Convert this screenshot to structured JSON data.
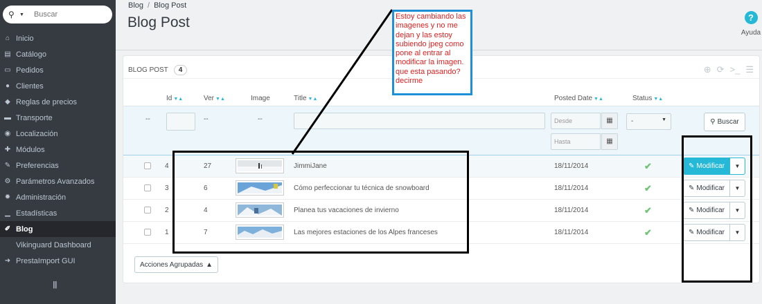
{
  "search": {
    "placeholder": "Buscar",
    "icon": "search-icon"
  },
  "sidebar": {
    "items": [
      {
        "label": "Inicio",
        "icon": "home-icon",
        "glyph": "⌂"
      },
      {
        "label": "Catálogo",
        "icon": "book-icon",
        "glyph": "▤"
      },
      {
        "label": "Pedidos",
        "icon": "credit-card-icon",
        "glyph": "▭"
      },
      {
        "label": "Clientes",
        "icon": "users-icon",
        "glyph": "●"
      },
      {
        "label": "Reglas de precios",
        "icon": "tag-icon",
        "glyph": "◆"
      },
      {
        "label": "Transporte",
        "icon": "truck-icon",
        "glyph": "▬"
      },
      {
        "label": "Localización",
        "icon": "globe-icon",
        "glyph": "◉"
      },
      {
        "label": "Módulos",
        "icon": "puzzle-icon",
        "glyph": "✚"
      },
      {
        "label": "Preferencias",
        "icon": "wrench-icon",
        "glyph": "✎"
      },
      {
        "label": "Parámetros Avanzados",
        "icon": "cogs-icon",
        "glyph": "⚙"
      },
      {
        "label": "Administración",
        "icon": "cog-icon",
        "glyph": "✹"
      },
      {
        "label": "Estadísticas",
        "icon": "bar-chart-icon",
        "glyph": "▁"
      },
      {
        "label": "Blog",
        "icon": "edit-icon",
        "glyph": "✐",
        "active": true
      },
      {
        "label": "Vikinguard Dashboard",
        "icon": "",
        "glyph": "",
        "sub": true
      },
      {
        "label": "PrestaImport GUI",
        "icon": "sign-in-icon",
        "glyph": "➜"
      }
    ]
  },
  "breadcrumb": {
    "root": "Blog",
    "current": "Blog Post"
  },
  "page": {
    "title": "Blog Post"
  },
  "help": {
    "label": "Ayuda",
    "icon": "question-circle-icon"
  },
  "panel": {
    "title": "BLOG POST",
    "count": "4",
    "tools": [
      "add-icon",
      "refresh-icon",
      "terminal-icon",
      "database-icon"
    ]
  },
  "table": {
    "headers": {
      "id": "Id",
      "ver": "Ver",
      "image": "Image",
      "title": "Title",
      "posted": "Posted Date",
      "status": "Status"
    },
    "filters": {
      "id_dash": "--",
      "ver_dash": "--",
      "img_dash": "--",
      "desde": "Desde",
      "hasta": "Hasta",
      "status_value": "-",
      "search_label": "Buscar"
    },
    "rows": [
      {
        "id": "4",
        "ver": "27",
        "title": "JimmiJane",
        "date": "18/11/2014",
        "action": "Modificar",
        "highlight": true
      },
      {
        "id": "3",
        "ver": "6",
        "title": "Cómo perfeccionar tu técnica de snowboard",
        "date": "18/11/2014",
        "action": "Modificar"
      },
      {
        "id": "2",
        "ver": "4",
        "title": "Planea tus vacaciones de invierno",
        "date": "18/11/2014",
        "action": "Modificar"
      },
      {
        "id": "1",
        "ver": "7",
        "title": "Las mejores estaciones de los Alpes franceses",
        "date": "18/11/2014",
        "action": "Modificar"
      }
    ],
    "bulk_label": "Acciones Agrupadas"
  },
  "annotation": {
    "text": "Estoy cambiando las imagenes y no me dejan y las estoy subiendo jpeg como pone al entrar al modificar la imagen. que esta pasando? decirme"
  },
  "colors": {
    "accent": "#25b9d7",
    "sidebar": "#363a41",
    "ok": "#72c279",
    "note_text": "#e02020",
    "note_border": "#1e90d8"
  }
}
